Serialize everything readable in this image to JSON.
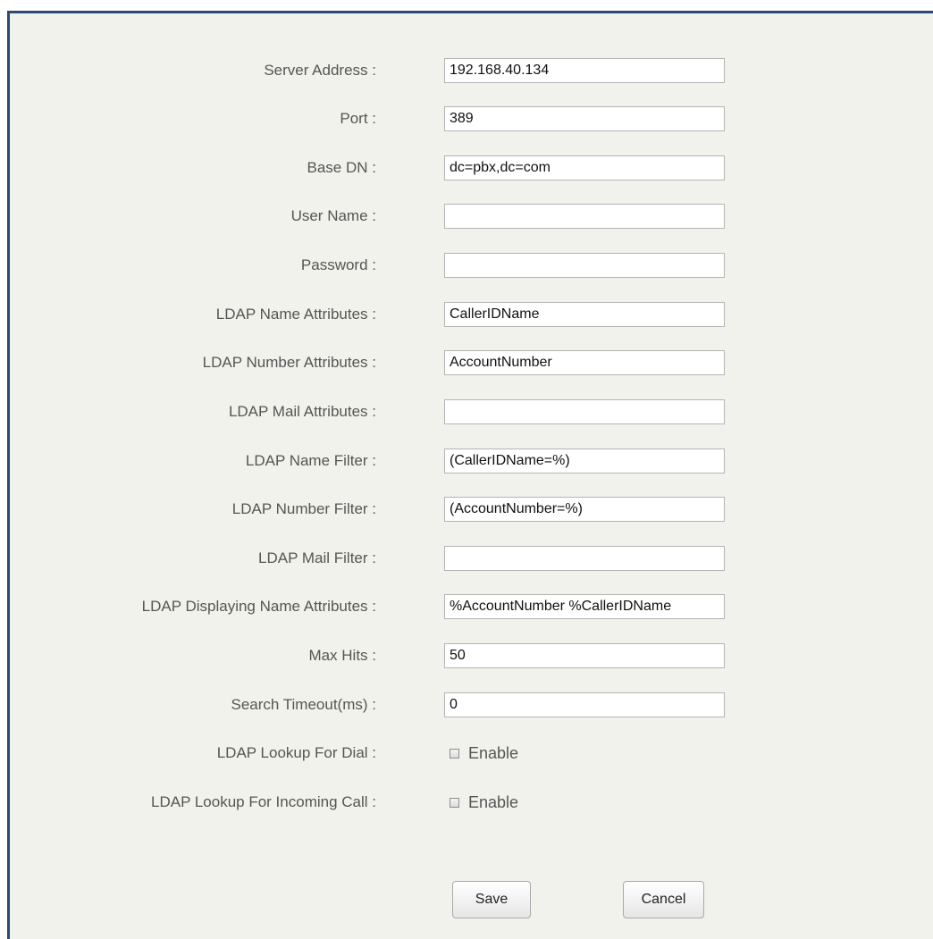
{
  "form": {
    "fields": [
      {
        "label": "Server Address :",
        "value": "192.168.40.134",
        "placeholder": ""
      },
      {
        "label": "Port :",
        "value": "389",
        "placeholder": ""
      },
      {
        "label": "Base DN :",
        "value": "dc=pbx,dc=com",
        "placeholder": ""
      },
      {
        "label": "User Name :",
        "value": "",
        "placeholder": ""
      },
      {
        "label": "Password :",
        "value": "",
        "placeholder": ""
      },
      {
        "label": "LDAP Name Attributes :",
        "value": "CallerIDName",
        "placeholder": ""
      },
      {
        "label": "LDAP Number Attributes :",
        "value": "AccountNumber",
        "placeholder": ""
      },
      {
        "label": "LDAP Mail Attributes :",
        "value": "",
        "placeholder": ""
      },
      {
        "label": "LDAP Name Filter :",
        "value": "(CallerIDName=%)",
        "placeholder": ""
      },
      {
        "label": "LDAP Number Filter :",
        "value": "(AccountNumber=%)",
        "placeholder": ""
      },
      {
        "label": "LDAP Mail Filter :",
        "value": "",
        "placeholder": ""
      },
      {
        "label": "LDAP Displaying Name Attributes :",
        "value": "%AccountNumber %CallerIDName",
        "placeholder": ""
      },
      {
        "label": "Max Hits :",
        "value": "50",
        "placeholder": ""
      },
      {
        "label": "Search Timeout(ms) :",
        "value": "0",
        "placeholder": ""
      }
    ],
    "checks": [
      {
        "label": "LDAP Lookup For Dial :",
        "option": "Enable",
        "checked": false
      },
      {
        "label": "LDAP Lookup For Incoming Call :",
        "option": "Enable",
        "checked": false
      }
    ]
  },
  "actions": {
    "save_label": "Save",
    "cancel_label": "Cancel"
  },
  "colors": {
    "panel_background": "#f2f2ec",
    "panel_border": "#2c4a72",
    "label_text": "#555555"
  }
}
